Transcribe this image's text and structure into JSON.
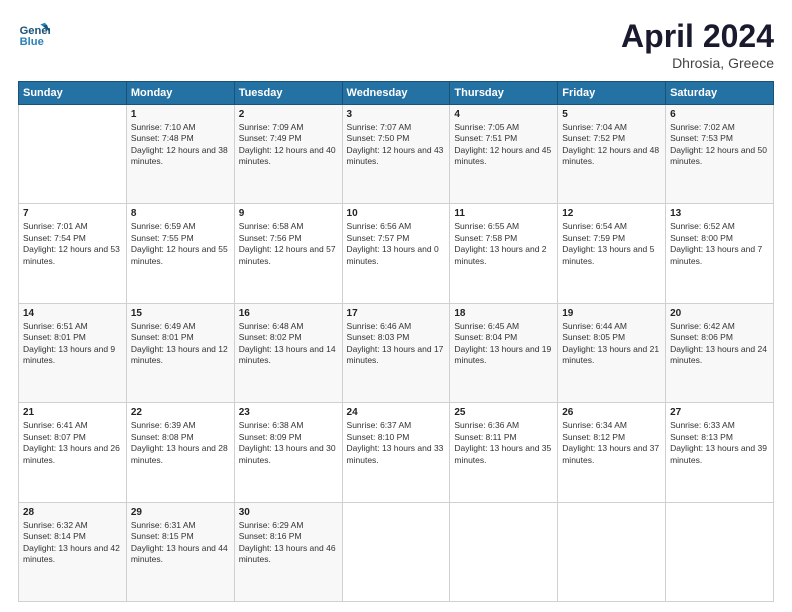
{
  "header": {
    "logo_line1": "General",
    "logo_line2": "Blue",
    "title": "April 2024",
    "subtitle": "Dhrosia, Greece"
  },
  "columns": [
    "Sunday",
    "Monday",
    "Tuesday",
    "Wednesday",
    "Thursday",
    "Friday",
    "Saturday"
  ],
  "weeks": [
    [
      {
        "day": "",
        "sunrise": "",
        "sunset": "",
        "daylight": ""
      },
      {
        "day": "1",
        "sunrise": "Sunrise: 7:10 AM",
        "sunset": "Sunset: 7:48 PM",
        "daylight": "Daylight: 12 hours and 38 minutes."
      },
      {
        "day": "2",
        "sunrise": "Sunrise: 7:09 AM",
        "sunset": "Sunset: 7:49 PM",
        "daylight": "Daylight: 12 hours and 40 minutes."
      },
      {
        "day": "3",
        "sunrise": "Sunrise: 7:07 AM",
        "sunset": "Sunset: 7:50 PM",
        "daylight": "Daylight: 12 hours and 43 minutes."
      },
      {
        "day": "4",
        "sunrise": "Sunrise: 7:05 AM",
        "sunset": "Sunset: 7:51 PM",
        "daylight": "Daylight: 12 hours and 45 minutes."
      },
      {
        "day": "5",
        "sunrise": "Sunrise: 7:04 AM",
        "sunset": "Sunset: 7:52 PM",
        "daylight": "Daylight: 12 hours and 48 minutes."
      },
      {
        "day": "6",
        "sunrise": "Sunrise: 7:02 AM",
        "sunset": "Sunset: 7:53 PM",
        "daylight": "Daylight: 12 hours and 50 minutes."
      }
    ],
    [
      {
        "day": "7",
        "sunrise": "Sunrise: 7:01 AM",
        "sunset": "Sunset: 7:54 PM",
        "daylight": "Daylight: 12 hours and 53 minutes."
      },
      {
        "day": "8",
        "sunrise": "Sunrise: 6:59 AM",
        "sunset": "Sunset: 7:55 PM",
        "daylight": "Daylight: 12 hours and 55 minutes."
      },
      {
        "day": "9",
        "sunrise": "Sunrise: 6:58 AM",
        "sunset": "Sunset: 7:56 PM",
        "daylight": "Daylight: 12 hours and 57 minutes."
      },
      {
        "day": "10",
        "sunrise": "Sunrise: 6:56 AM",
        "sunset": "Sunset: 7:57 PM",
        "daylight": "Daylight: 13 hours and 0 minutes."
      },
      {
        "day": "11",
        "sunrise": "Sunrise: 6:55 AM",
        "sunset": "Sunset: 7:58 PM",
        "daylight": "Daylight: 13 hours and 2 minutes."
      },
      {
        "day": "12",
        "sunrise": "Sunrise: 6:54 AM",
        "sunset": "Sunset: 7:59 PM",
        "daylight": "Daylight: 13 hours and 5 minutes."
      },
      {
        "day": "13",
        "sunrise": "Sunrise: 6:52 AM",
        "sunset": "Sunset: 8:00 PM",
        "daylight": "Daylight: 13 hours and 7 minutes."
      }
    ],
    [
      {
        "day": "14",
        "sunrise": "Sunrise: 6:51 AM",
        "sunset": "Sunset: 8:01 PM",
        "daylight": "Daylight: 13 hours and 9 minutes."
      },
      {
        "day": "15",
        "sunrise": "Sunrise: 6:49 AM",
        "sunset": "Sunset: 8:01 PM",
        "daylight": "Daylight: 13 hours and 12 minutes."
      },
      {
        "day": "16",
        "sunrise": "Sunrise: 6:48 AM",
        "sunset": "Sunset: 8:02 PM",
        "daylight": "Daylight: 13 hours and 14 minutes."
      },
      {
        "day": "17",
        "sunrise": "Sunrise: 6:46 AM",
        "sunset": "Sunset: 8:03 PM",
        "daylight": "Daylight: 13 hours and 17 minutes."
      },
      {
        "day": "18",
        "sunrise": "Sunrise: 6:45 AM",
        "sunset": "Sunset: 8:04 PM",
        "daylight": "Daylight: 13 hours and 19 minutes."
      },
      {
        "day": "19",
        "sunrise": "Sunrise: 6:44 AM",
        "sunset": "Sunset: 8:05 PM",
        "daylight": "Daylight: 13 hours and 21 minutes."
      },
      {
        "day": "20",
        "sunrise": "Sunrise: 6:42 AM",
        "sunset": "Sunset: 8:06 PM",
        "daylight": "Daylight: 13 hours and 24 minutes."
      }
    ],
    [
      {
        "day": "21",
        "sunrise": "Sunrise: 6:41 AM",
        "sunset": "Sunset: 8:07 PM",
        "daylight": "Daylight: 13 hours and 26 minutes."
      },
      {
        "day": "22",
        "sunrise": "Sunrise: 6:39 AM",
        "sunset": "Sunset: 8:08 PM",
        "daylight": "Daylight: 13 hours and 28 minutes."
      },
      {
        "day": "23",
        "sunrise": "Sunrise: 6:38 AM",
        "sunset": "Sunset: 8:09 PM",
        "daylight": "Daylight: 13 hours and 30 minutes."
      },
      {
        "day": "24",
        "sunrise": "Sunrise: 6:37 AM",
        "sunset": "Sunset: 8:10 PM",
        "daylight": "Daylight: 13 hours and 33 minutes."
      },
      {
        "day": "25",
        "sunrise": "Sunrise: 6:36 AM",
        "sunset": "Sunset: 8:11 PM",
        "daylight": "Daylight: 13 hours and 35 minutes."
      },
      {
        "day": "26",
        "sunrise": "Sunrise: 6:34 AM",
        "sunset": "Sunset: 8:12 PM",
        "daylight": "Daylight: 13 hours and 37 minutes."
      },
      {
        "day": "27",
        "sunrise": "Sunrise: 6:33 AM",
        "sunset": "Sunset: 8:13 PM",
        "daylight": "Daylight: 13 hours and 39 minutes."
      }
    ],
    [
      {
        "day": "28",
        "sunrise": "Sunrise: 6:32 AM",
        "sunset": "Sunset: 8:14 PM",
        "daylight": "Daylight: 13 hours and 42 minutes."
      },
      {
        "day": "29",
        "sunrise": "Sunrise: 6:31 AM",
        "sunset": "Sunset: 8:15 PM",
        "daylight": "Daylight: 13 hours and 44 minutes."
      },
      {
        "day": "30",
        "sunrise": "Sunrise: 6:29 AM",
        "sunset": "Sunset: 8:16 PM",
        "daylight": "Daylight: 13 hours and 46 minutes."
      },
      {
        "day": "",
        "sunrise": "",
        "sunset": "",
        "daylight": ""
      },
      {
        "day": "",
        "sunrise": "",
        "sunset": "",
        "daylight": ""
      },
      {
        "day": "",
        "sunrise": "",
        "sunset": "",
        "daylight": ""
      },
      {
        "day": "",
        "sunrise": "",
        "sunset": "",
        "daylight": ""
      }
    ]
  ]
}
